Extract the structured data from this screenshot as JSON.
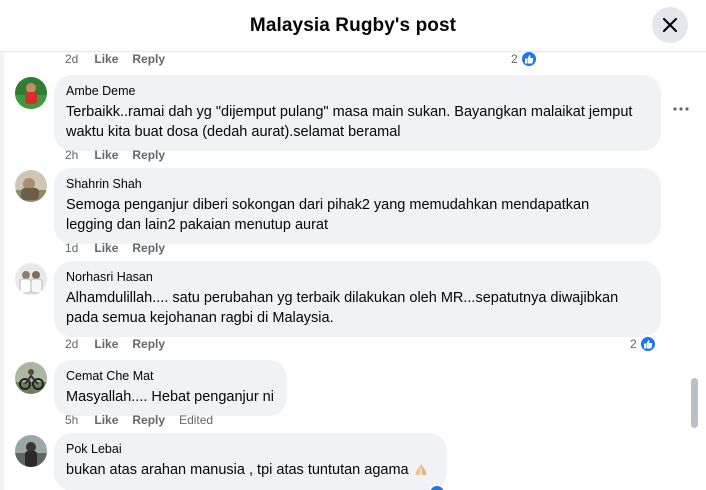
{
  "header": {
    "title": "Malaysia Rugby's post"
  },
  "comments": [
    {
      "time": "2d",
      "like": "Like",
      "reply": "Reply",
      "reactions": "2"
    },
    {
      "author": "Ambe Deme",
      "text": "Terbaikk..ramai dah yg \"dijemput pulang\" masa main sukan. Bayangkan malaikat jemput\nwaktu kita buat dosa (dedah aurat).selamat beramal",
      "time": "2h",
      "like": "Like",
      "reply": "Reply"
    },
    {
      "author": "Shahrin Shah",
      "text": "Semoga penganjur diberi sokongan dari pihak2 yang memudahkan mendapatkan\nlegging dan lain2 pakaian menutup aurat",
      "time": "1d",
      "like": "Like",
      "reply": "Reply"
    },
    {
      "author": "Norhasri Hasan",
      "text": "Alhamdulillah.... satu perubahan yg terbaik dilakukan oleh MR...sepatutnya diwajibkan\npada semua kejohanan ragbi di Malaysia.",
      "time": "2d",
      "like": "Like",
      "reply": "Reply",
      "reactions": "2"
    },
    {
      "author": "Cemat Che Mat",
      "text": "Masyallah.... Hebat penganjur ni",
      "time": "5h",
      "like": "Like",
      "reply": "Reply",
      "edited": "Edited"
    },
    {
      "author": "Pok Lebai",
      "text": "bukan atas arahan manusia , tpi atas tuntutan agama"
    }
  ],
  "icons": {
    "close": "close-icon",
    "more": "more-options-icon",
    "like": "like-thumb-icon",
    "emoji": "praying-hands-emoji"
  },
  "colors": {
    "facebook_blue": "#1877f2",
    "bubble_bg": "#f0f2f5",
    "meta_text": "#65676b"
  }
}
